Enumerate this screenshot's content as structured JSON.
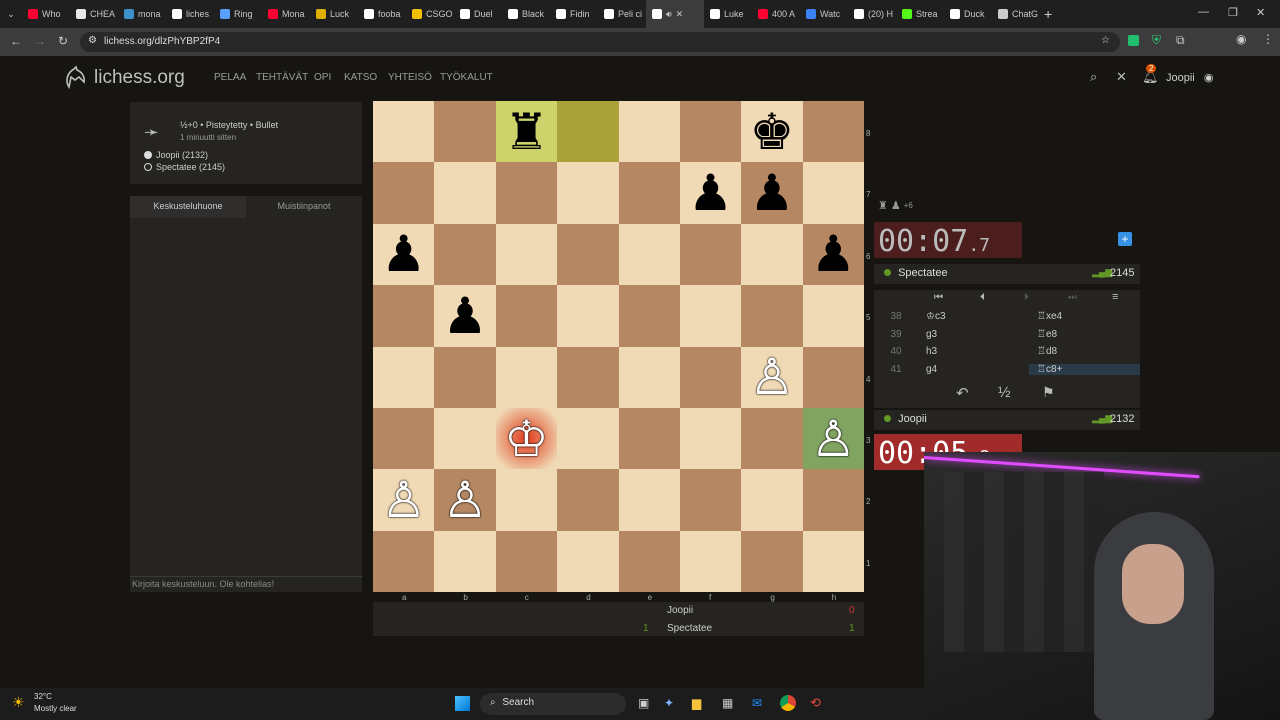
{
  "browser": {
    "tabs": [
      {
        "label": "Who",
        "icon": "youtube-icon",
        "color": "#ff0033"
      },
      {
        "label": "CHEA",
        "icon": "document-icon",
        "color": "#e8e8e8"
      },
      {
        "label": "mona",
        "icon": "wordpress-icon",
        "color": "#3d8fcc"
      },
      {
        "label": "liches",
        "icon": "lichess-icon",
        "color": "#ffffff"
      },
      {
        "label": "Ring",
        "icon": "ring-icon",
        "color": "#5aa0ff"
      },
      {
        "label": "Mona",
        "icon": "youtube-icon",
        "color": "#ff0033"
      },
      {
        "label": "Luck",
        "icon": "slack-icon",
        "color": "#e0b000"
      },
      {
        "label": "fooba",
        "icon": "x-icon",
        "color": "#ffffff"
      },
      {
        "label": "CSGO",
        "icon": "csgo-icon",
        "color": "#f0c000"
      },
      {
        "label": "Duel",
        "icon": "duel-icon",
        "color": "#ffffff"
      },
      {
        "label": "Black",
        "icon": "doc-icon",
        "color": "#ffffff"
      },
      {
        "label": "Fidin",
        "icon": "x-icon",
        "color": "#ffffff"
      },
      {
        "label": "Peli ci",
        "icon": "lichess-icon",
        "color": "#ffffff"
      },
      {
        "label": "Luke",
        "icon": "x-icon",
        "color": "#ffffff"
      },
      {
        "label": "400 A",
        "icon": "youtube-icon",
        "color": "#ff0033"
      },
      {
        "label": "Watc",
        "icon": "watch-icon",
        "color": "#3b82f6"
      },
      {
        "label": "(20) H",
        "icon": "x-icon",
        "color": "#ffffff"
      },
      {
        "label": "Strea",
        "icon": "kick-icon",
        "color": "#53fc18"
      },
      {
        "label": "Duck",
        "icon": "duck-icon",
        "color": "#ffffff"
      },
      {
        "label": "ChatG",
        "icon": "chatgpt-icon",
        "color": "#cccccc"
      }
    ],
    "active_tab_icon": "lichess-icon",
    "url": "lichess.org/dlzPhYBP2fP4"
  },
  "header": {
    "logo": "lichess.org",
    "nav": [
      "PELAA",
      "TEHTÄVÄT",
      "OPI",
      "KATSO",
      "YHTEISÖ",
      "TYÖKALUT"
    ],
    "username": "Joopii",
    "notification_count": "2"
  },
  "game_info": {
    "format": "½+0 • Pisteytetty • Bullet",
    "time_ago": "1 minuutti sitten",
    "white_player": "Joopii (2132)",
    "black_player": "Spectatee (2145)"
  },
  "chat": {
    "tab_chat": "Keskusteluhuone",
    "tab_notes": "Muistiinpanot",
    "placeholder": "Kirjoita keskusteluun. Ole kohtelias!"
  },
  "board": {
    "ranks": [
      "8",
      "7",
      "6",
      "5",
      "4",
      "3",
      "2",
      "1"
    ],
    "files": [
      "a",
      "b",
      "c",
      "d",
      "e",
      "f",
      "g",
      "h"
    ],
    "highlights": {
      "c8": "#cdd26a",
      "d8": "#aaa23a",
      "c3": "#e03b1a",
      "h3": "#81a461"
    },
    "pieces": [
      {
        "sq": "c8",
        "glyph": "♜",
        "side": "b"
      },
      {
        "sq": "g8",
        "glyph": "♚",
        "side": "b"
      },
      {
        "sq": "f7",
        "glyph": "♟",
        "side": "b"
      },
      {
        "sq": "g7",
        "glyph": "♟",
        "side": "b"
      },
      {
        "sq": "a6",
        "glyph": "♟",
        "side": "b"
      },
      {
        "sq": "h6",
        "glyph": "♟",
        "side": "b"
      },
      {
        "sq": "b5",
        "glyph": "♟",
        "side": "b"
      },
      {
        "sq": "g4",
        "glyph": "♙",
        "side": "w"
      },
      {
        "sq": "c3",
        "glyph": "♔",
        "side": "w"
      },
      {
        "sq": "h3",
        "glyph": "♙",
        "side": "w"
      },
      {
        "sq": "a2",
        "glyph": "♙",
        "side": "w"
      },
      {
        "sq": "b2",
        "glyph": "♙",
        "side": "w"
      }
    ]
  },
  "opponent": {
    "material": "+6",
    "clock": "00:07",
    "clock_tenths": ".7",
    "name": "Spectatee",
    "rating": "2145"
  },
  "me": {
    "clock": "00:05",
    "clock_tenths": ".8",
    "name": "Joopii",
    "rating": "2132"
  },
  "moves": [
    {
      "num": "38",
      "white": "♔c3",
      "black": "♖xe4"
    },
    {
      "num": "39",
      "white": "g3",
      "black": "♖e8"
    },
    {
      "num": "40",
      "white": "h3",
      "black": "♖d8"
    },
    {
      "num": "41",
      "white": "g4",
      "black": "♖c8+"
    }
  ],
  "actions": {
    "draw": "½"
  },
  "scoretable": {
    "row1_name": "Joopii",
    "row1_score": "0",
    "row2_name": "Spectatee",
    "row2_left": "1",
    "row2_score": "1"
  },
  "taskbar": {
    "temperature": "32°C",
    "weather": "Mostly clear",
    "search_label": "Search"
  },
  "colors": {
    "accent": "#3692e7",
    "danger": "#c33",
    "online": "#629924"
  }
}
